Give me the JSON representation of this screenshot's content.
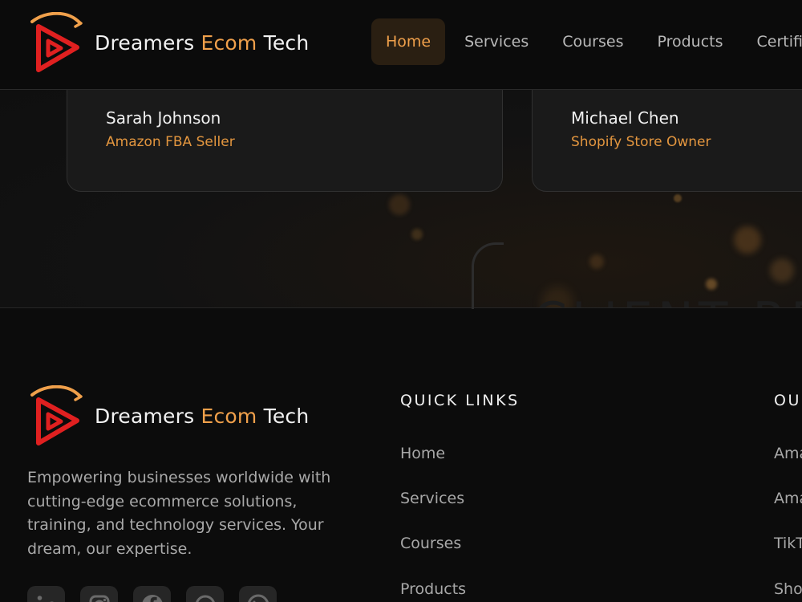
{
  "brand": {
    "name_part1": "Dreamers ",
    "name_part2": "Ecom",
    "name_part3": " Tech",
    "accent_color": "#f0a04b",
    "logo_colors": [
      "#e02020",
      "#f0a04b"
    ]
  },
  "nav": {
    "items": [
      {
        "label": "Home",
        "active": true
      },
      {
        "label": "Services"
      },
      {
        "label": "Courses"
      },
      {
        "label": "Products"
      },
      {
        "label": "Certifi"
      }
    ]
  },
  "testimonials": {
    "cards": [
      {
        "name": "Sarah Johnson",
        "role": "Amazon FBA Seller"
      },
      {
        "name": "Michael Chen",
        "role": "Shopify Store Owner"
      }
    ],
    "watermark": "CLIENT RE"
  },
  "footer": {
    "description": "Empowering businesses worldwide with cutting-edge ecommerce solutions, training, and technology services. Your dream, our expertise.",
    "quick_links": {
      "title": "QUICK LINKS",
      "links": [
        "Home",
        "Services",
        "Courses",
        "Products"
      ]
    },
    "our_col": {
      "title": "OU",
      "links": [
        "Ama",
        "Ama",
        "TikT",
        "Sho"
      ]
    },
    "socials": [
      "linkedin-icon",
      "instagram-icon",
      "facebook-icon",
      "whatsapp-icon",
      "whatsapp-outline-icon"
    ]
  }
}
